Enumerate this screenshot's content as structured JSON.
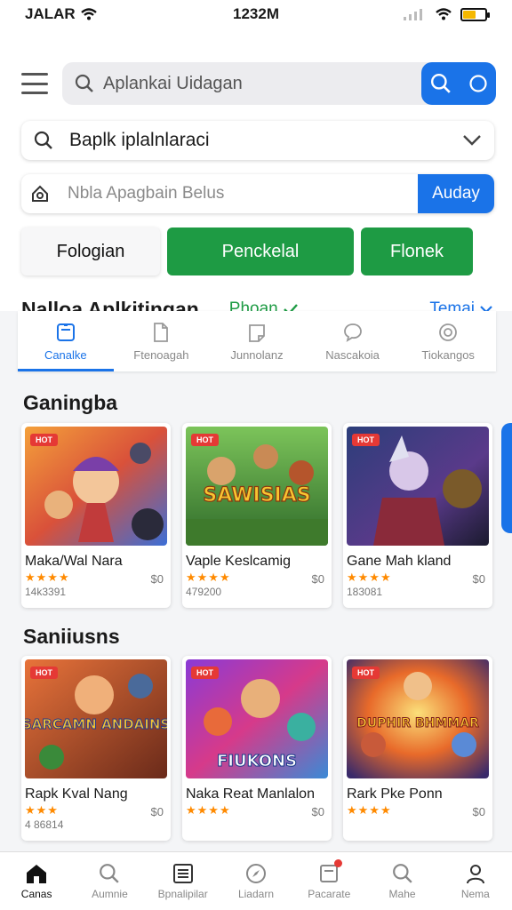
{
  "status_bar": {
    "carrier": "JALAR",
    "time": "1232M"
  },
  "search": {
    "placeholder": "Aplankai Uidagan"
  },
  "filter_select": {
    "value": "Baplk iplalnlaraci"
  },
  "secondary_search": {
    "placeholder": "Nbla Apagbain Belus",
    "button_label": "Auday"
  },
  "buttons": [
    {
      "label": "Fologian"
    },
    {
      "label": "Penckelal"
    },
    {
      "label": "Flonek"
    }
  ],
  "page_heading": {
    "title": "Nalloa Aplkitingan",
    "status": "Phoan",
    "theme": "Temai"
  },
  "tabs": [
    {
      "label": "Canalke",
      "icon": "document-icon",
      "active": true
    },
    {
      "label": "Ftenoagah",
      "icon": "file-icon",
      "active": false
    },
    {
      "label": "Junnolanz",
      "icon": "note-icon",
      "active": false
    },
    {
      "label": "Nascakoia",
      "icon": "chat-bubble-icon",
      "active": false
    },
    {
      "label": "Tiokangos",
      "icon": "badge-icon",
      "active": false
    }
  ],
  "sections": [
    {
      "title": "Ganingba",
      "cards": [
        {
          "name": "Maka/Wal Nara",
          "stars": "★★★★",
          "price": "$0",
          "downloads": "14k3391",
          "tag": "HOT"
        },
        {
          "name": "Vaple Keslcamig",
          "stars": "★★★★",
          "price": "$0",
          "downloads": "479200",
          "tag": "HOT",
          "art_title": "SAWISIAS"
        },
        {
          "name": "Gane Mah kland",
          "stars": "★★★★",
          "price": "$0",
          "downloads": "183081",
          "tag": "HOT"
        }
      ]
    },
    {
      "title": "Saniiusns",
      "cards": [
        {
          "name": "Rapk Kval Nang",
          "stars": "★★★",
          "price": "$0",
          "downloads": "4 86814",
          "tag": "HOT",
          "art_title": "SARCAMN ANDAINS"
        },
        {
          "name": "Naka Reat Manlalon",
          "stars": "★★★★",
          "price": "$0",
          "downloads": "",
          "tag": "HOT",
          "art_title": "FIUKONS"
        },
        {
          "name": "Rark Pke Ponn",
          "stars": "★★★★",
          "price": "$0",
          "downloads": "",
          "tag": "HOT",
          "art_title": "DUPHIR BHMMAR"
        }
      ]
    }
  ],
  "bottom_nav": [
    {
      "label": "Canas",
      "icon": "home-icon",
      "active": true
    },
    {
      "label": "Aumnie",
      "icon": "search-icon",
      "active": false
    },
    {
      "label": "Bpnalipilar",
      "icon": "list-icon",
      "active": false
    },
    {
      "label": "Liadarn",
      "icon": "compass-icon",
      "active": false
    },
    {
      "label": "Pacarate",
      "icon": "inbox-icon",
      "active": false,
      "badge": true
    },
    {
      "label": "Mahe",
      "icon": "search-icon",
      "active": false
    },
    {
      "label": "Nema",
      "icon": "profile-icon",
      "active": false
    }
  ],
  "colors": {
    "accent_blue": "#1a73e8",
    "green": "#1e9b44",
    "tag_red": "#e53935",
    "star_orange": "#ff8a00"
  }
}
